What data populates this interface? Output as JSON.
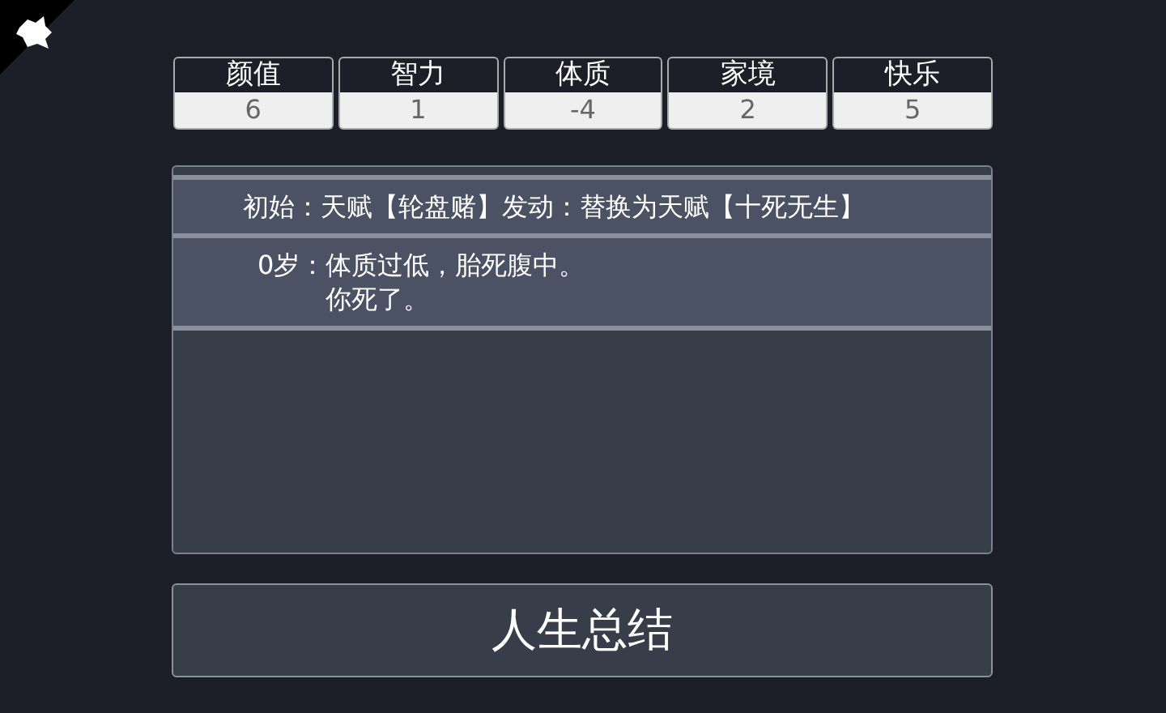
{
  "properties": [
    {
      "label": "颜值",
      "value": "6"
    },
    {
      "label": "智力",
      "value": "1"
    },
    {
      "label": "体质",
      "value": "-4"
    },
    {
      "label": "家境",
      "value": "2"
    },
    {
      "label": "快乐",
      "value": "5"
    }
  ],
  "log": [
    {
      "prefix": "初始：",
      "lines": [
        "天赋【轮盘赌】发动：替换为天赋【十死无生】"
      ]
    },
    {
      "prefix": "0岁：",
      "lines": [
        "体质过低，胎死腹中。",
        "你死了。"
      ]
    }
  ],
  "summary_button": "人生总结"
}
